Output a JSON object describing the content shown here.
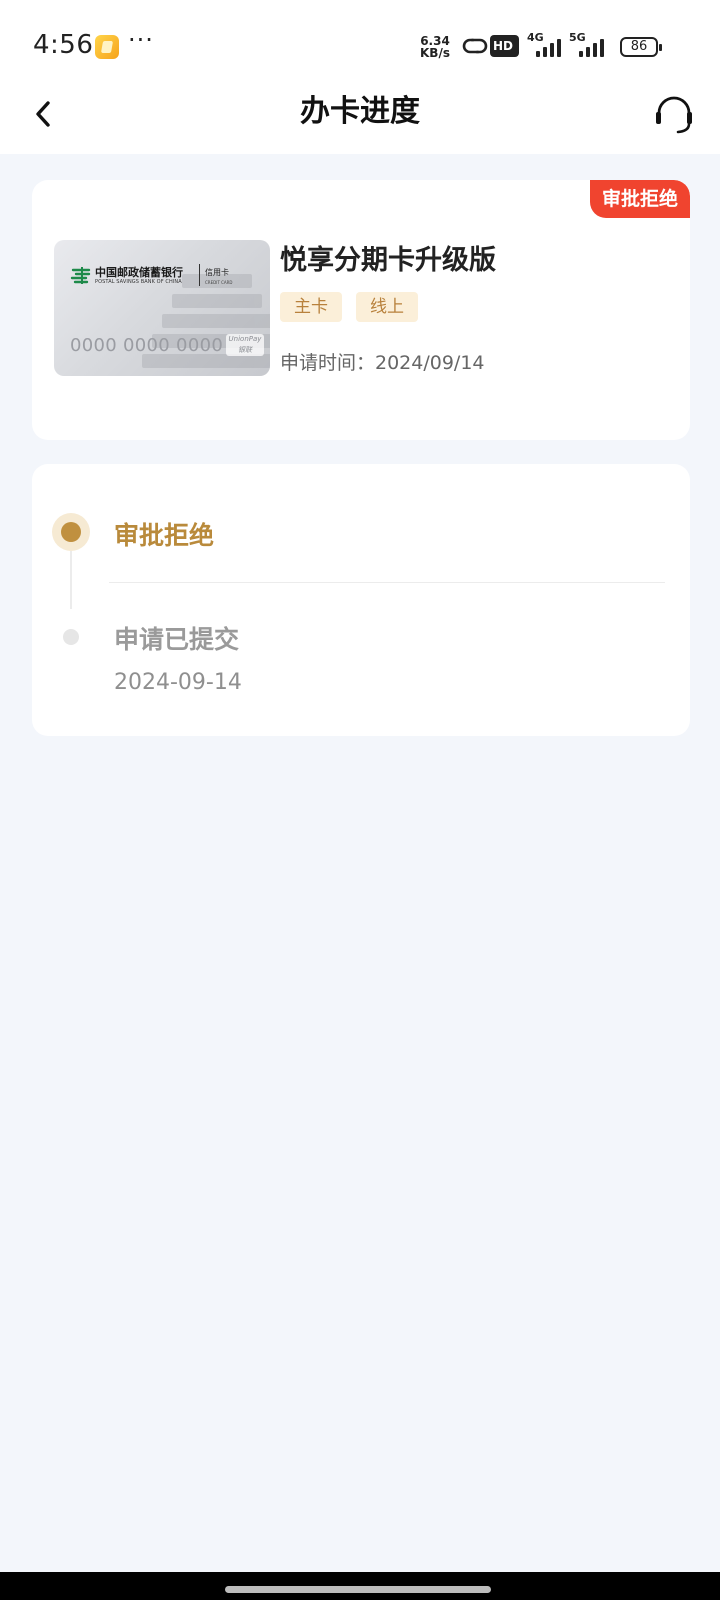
{
  "status_bar": {
    "time": "4:56",
    "more": "···",
    "net_speed_value": "6.34",
    "net_speed_unit": "KB/s",
    "hd_label": "HD",
    "signal_1_label": "4G",
    "signal_2_label": "5G",
    "battery": "86"
  },
  "nav": {
    "title": "办卡进度"
  },
  "card": {
    "status_badge": "审批拒绝",
    "bank_name": "中国邮政储蓄银行",
    "bank_name_en": "POSTAL SAVINGS BANK OF CHINA",
    "card_type": "信用卡",
    "card_type_en": "CREDIT CARD",
    "card_number": "0000 0000 0000",
    "union_pay_label": "UnionPay",
    "union_pay_cn": "银联",
    "product_name": "悦享分期卡升级版",
    "tags": [
      "主卡",
      "线上"
    ],
    "apply_time": "申请时间：2024/09/14"
  },
  "progress": {
    "steps": [
      {
        "title": "审批拒绝",
        "active": true
      },
      {
        "title": "申请已提交",
        "date": "2024-09-14",
        "active": false
      }
    ]
  },
  "colors": {
    "badge_red": "#f0442f",
    "gold_accent": "#b98a3b",
    "tag_bg": "#fbefd9",
    "page_bg": "#f3f6fb"
  },
  "icons": [
    "notification-app-icon",
    "link-icon",
    "back-chevron-icon",
    "customer-service-headset-icon",
    "postal-bank-logo-icon"
  ]
}
